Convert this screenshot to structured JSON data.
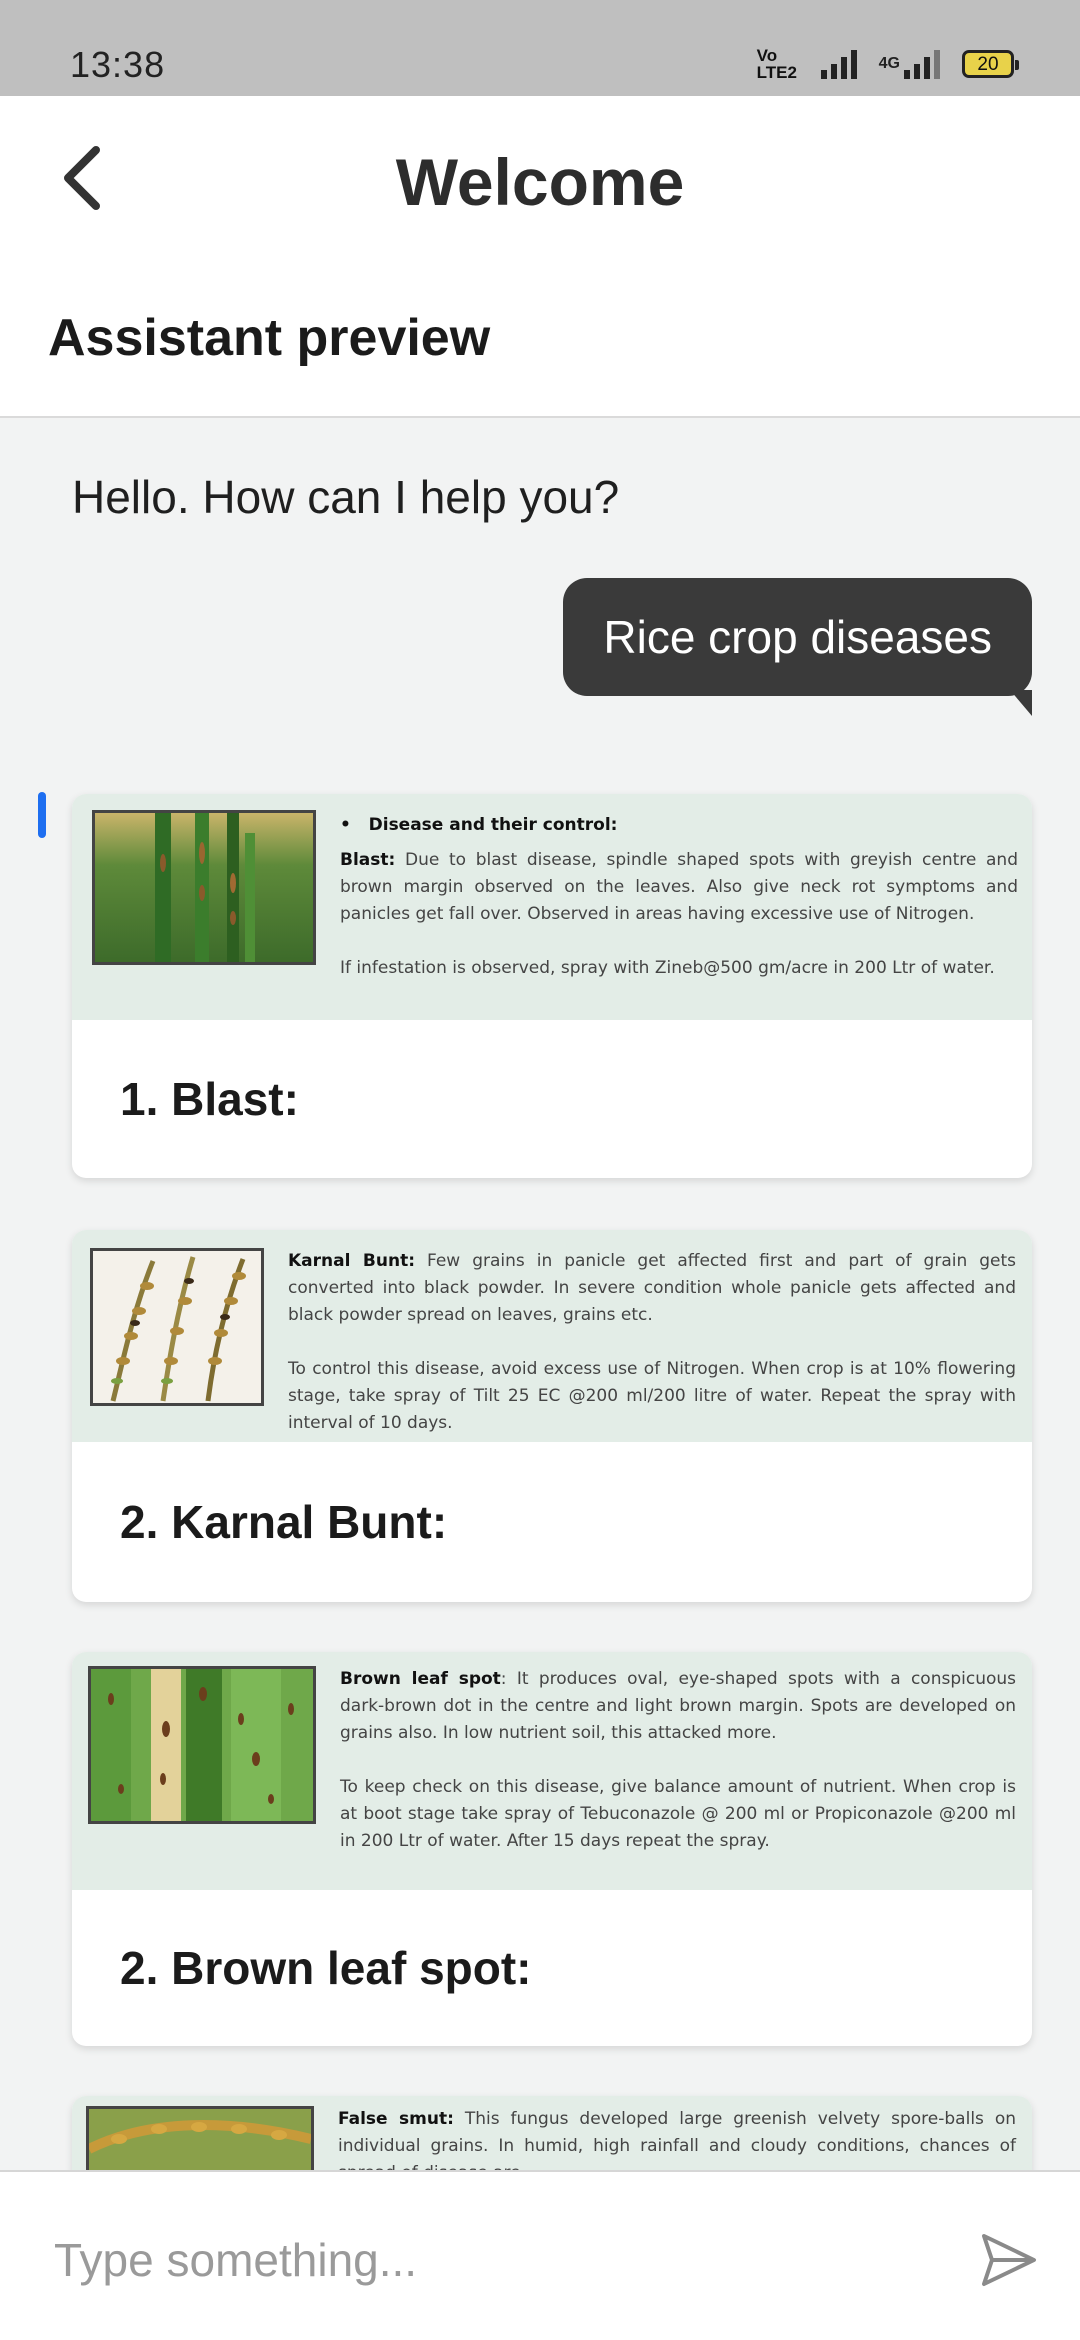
{
  "status_bar": {
    "time": "13:38",
    "volte": "Vo LTE2",
    "network": "4G",
    "battery": "20"
  },
  "header": {
    "title": "Welcome",
    "section_title": "Assistant preview"
  },
  "chat": {
    "greeting": "Hello. How can I help you?",
    "user_message": "Rice crop diseases",
    "cards": [
      {
        "bullet": "Disease and their control:",
        "name": "Blast:",
        "description": " Due to blast disease, spindle shaped spots with greyish centre and brown margin observed on the leaves. Also give neck rot symptoms and panicles get fall over. Observed in areas having excessive use of Nitrogen.",
        "control": "If infestation is observed, spray with Zineb@500 gm/acre in 200 Ltr of water.",
        "heading": "1. Blast:"
      },
      {
        "name": "Karnal Bunt:",
        "description": " Few grains in panicle get affected first and part of grain gets converted into black powder. In severe condition whole panicle gets affected and black powder spread on leaves, grains etc.",
        "control": "To control this disease, avoid excess use of Nitrogen. When crop is at 10% flowering stage, take spray of Tilt 25 EC @200 ml/200 litre of water. Repeat the spray with interval of 10 days.",
        "heading": "2. Karnal Bunt:"
      },
      {
        "name": "Brown leaf spot",
        "description": ": It produces oval, eye-shaped spots with a conspicuous dark-brown dot in the centre and light brown margin. Spots are developed on grains also. In low nutrient soil, this attacked more.",
        "control": "To keep check on this disease, give balance amount of nutrient. When crop is at boot stage take spray of Tebuconazole @ 200 ml or Propiconazole @200 ml in 200 Ltr of water. After 15 days repeat the spray.",
        "heading": "2. Brown leaf spot:"
      },
      {
        "name": "False smut:",
        "description": " This fungus developed large greenish velvety spore-balls on individual grains. In humid, high rainfall and cloudy conditions, chances of spread of disease are"
      }
    ]
  },
  "input": {
    "placeholder": "Type something..."
  },
  "colors": {
    "status_bar": "#bfbfbf",
    "user_bubble": "#3a3a3a",
    "card_figure_bg": "#e3ede7",
    "scroll_indicator": "#1e6ef0",
    "battery_fill": "#e8d24a"
  },
  "icons": {
    "back": "chevron-left-icon",
    "send": "send-icon",
    "signal": "signal-icon",
    "battery": "battery-icon"
  }
}
